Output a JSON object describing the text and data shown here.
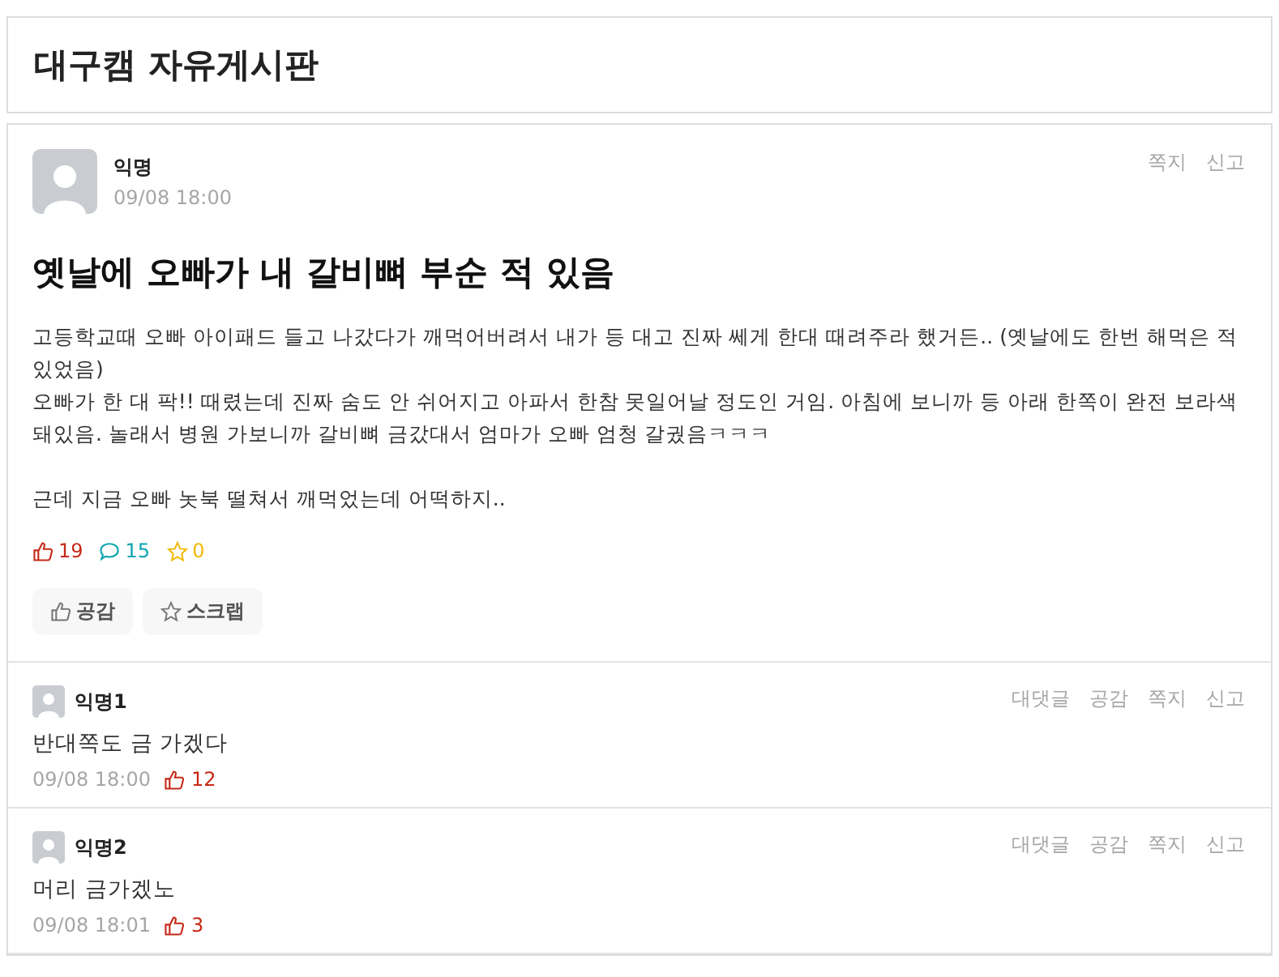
{
  "board": {
    "title": "대구캠 자유게시판"
  },
  "post": {
    "author": "익명",
    "time": "09/08 18:00",
    "actions": [
      "쪽지",
      "신고"
    ],
    "title": "옛날에 오빠가 내 갈비뼈 부순 적 있음",
    "body": "고등학교때 오빠 아이패드 들고 나갔다가 깨먹어버려서 내가 등 대고 진짜 쎄게 한대 때려주라 했거든.. (옛날에도 한번 해먹은 적 있었음)\n오빠가 한 대 팍!! 때렸는데 진짜 숨도 안 쉬어지고 아파서 한참 못일어날 정도인 거임. 아침에 보니까 등 아래 한쪽이 완전 보라색 돼있음. 놀래서 병원 가보니까 갈비뼈 금갔대서 엄마가 오빠 엄청 갈궜음ㅋㅋㅋ\n\n근데 지금 오빠 놋북 떨쳐서 깨먹었는데 어떡하지..",
    "stats": [
      {
        "kind": "like",
        "count": "19"
      },
      {
        "kind": "comment",
        "count": "15"
      },
      {
        "kind": "scrap",
        "count": "0"
      }
    ],
    "buttons": [
      {
        "kind": "like",
        "label": "공감"
      },
      {
        "kind": "scrap",
        "label": "스크랩"
      }
    ]
  },
  "comments": [
    {
      "author": "익명1",
      "text": "반대쪽도 금 가겠다",
      "time": "09/08 18:00",
      "likes": "12",
      "actions": [
        "대댓글",
        "공감",
        "쪽지",
        "신고"
      ]
    },
    {
      "author": "익명2",
      "text": "머리 금가겠노",
      "time": "09/08 18:01",
      "likes": "3",
      "actions": [
        "대댓글",
        "공감",
        "쪽지",
        "신고"
      ]
    }
  ]
}
